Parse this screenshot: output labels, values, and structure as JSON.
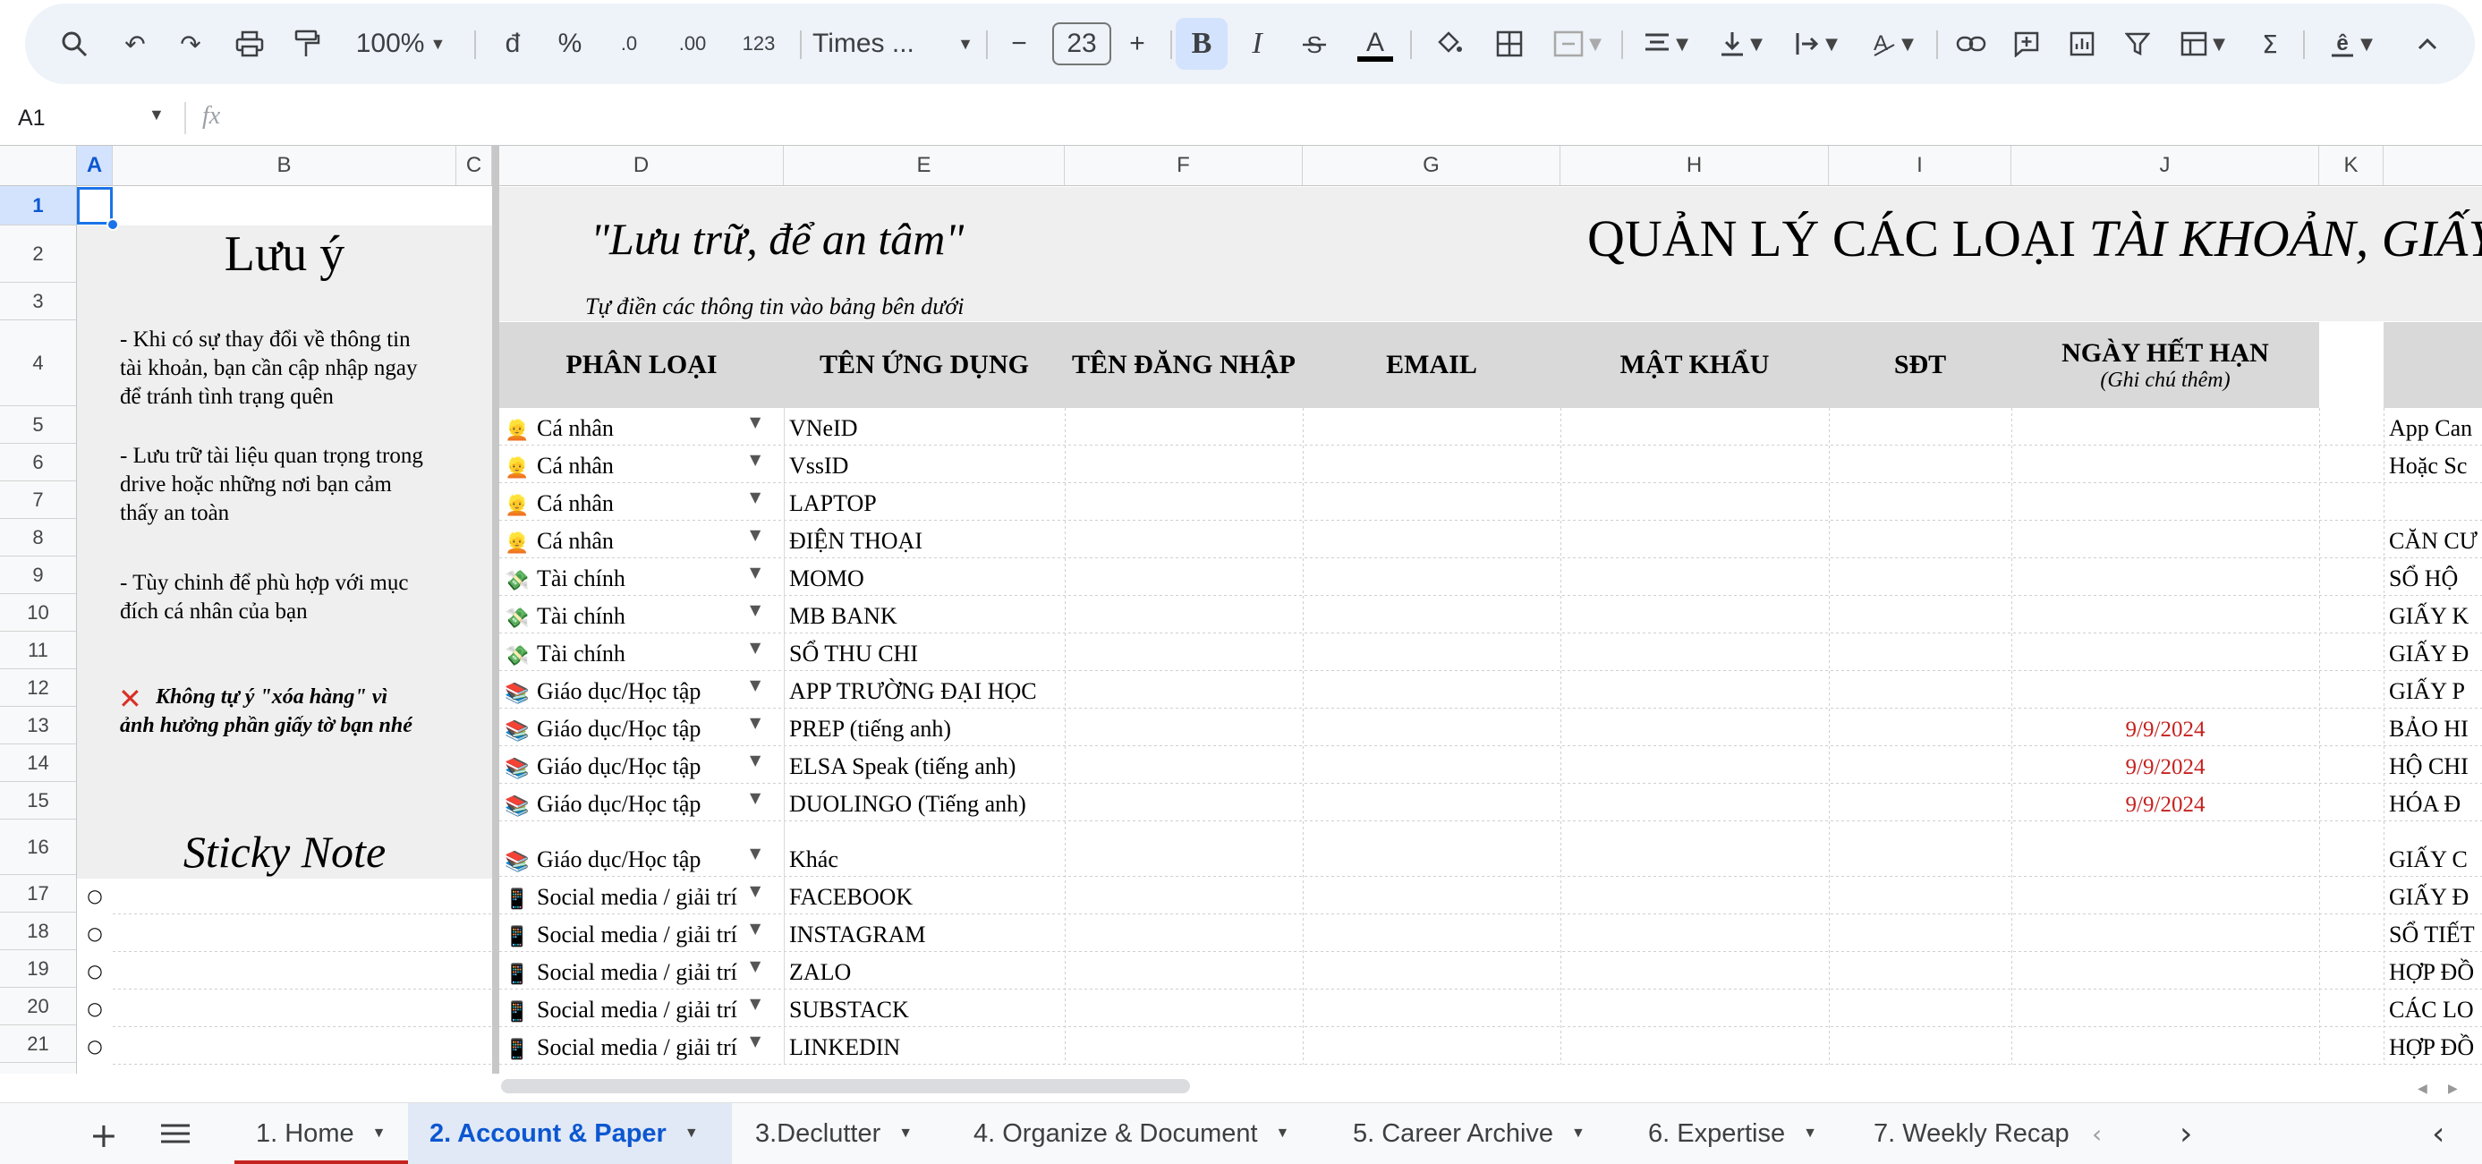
{
  "toolbar": {
    "zoom": "100%",
    "currency": "đ",
    "percent": "%",
    "dec_decrease": ".0",
    "dec_increase": ".00",
    "number_format": "123",
    "font_name": "Times ...",
    "font_size": "23",
    "bold": "B",
    "italic": "I"
  },
  "formula_bar": {
    "name_box": "A1",
    "fx": "fx"
  },
  "columns": [
    "A",
    "B",
    "C",
    "D",
    "E",
    "F",
    "G",
    "H",
    "I",
    "J",
    "K"
  ],
  "rows": [
    "1",
    "2",
    "3",
    "4",
    "5",
    "6",
    "7",
    "8",
    "9",
    "10",
    "11",
    "12",
    "13",
    "14",
    "15",
    "16",
    "17",
    "18",
    "19",
    "20",
    "21"
  ],
  "notes_panel": {
    "title": "Lưu ý",
    "note1_line1": "- Khi có sự thay đổi về thông tin",
    "note1_line2": "tài khoản, bạn cần cập nhập ngay",
    "note1_line3": "để tránh tình trạng quên",
    "note2_line1": "- Lưu trữ tài liệu quan trọng trong",
    "note2_line2": "drive hoặc những nơi bạn cảm",
    "note2_line3": "thấy an toàn",
    "note3_line1": "- Tùy chinh để phù hợp với mục",
    "note3_line2": "đích cá nhân của bạn",
    "warning_icon": "✕",
    "warning_line1": "Không tự ý \"xóa hàng\" vì",
    "warning_line2": "ảnh hưởng phần giấy tờ bạn nhé",
    "sticky_title": "Sticky Note",
    "bullet": "○"
  },
  "banner": {
    "slogan": "\"Lưu trữ, để an tâm\"",
    "title_plain": "QUẢN LÝ CÁC LOẠI ",
    "title_italic": "TÀI KHOẢN, GIẤY",
    "instruction": "Tự điền các thông tin vào bảng bên dưới"
  },
  "table_headers": {
    "category": "PHÂN LOẠI",
    "app_name": "TÊN ỨNG DỤNG",
    "username": "TÊN ĐĂNG NHẬP",
    "email": "EMAIL",
    "password": "MẬT KHẨU",
    "phone": "SĐT",
    "expiry": "NGÀY HẾT HẠN",
    "expiry_note": "(Ghi chú thêm)"
  },
  "accounts": [
    {
      "icon": "👱",
      "category": "Cá nhân",
      "app": "VNeID",
      "expiry": "",
      "right": "App Can"
    },
    {
      "icon": "👱",
      "category": "Cá nhân",
      "app": "VssID",
      "expiry": "",
      "right": "Hoặc Sc"
    },
    {
      "icon": "👱",
      "category": "Cá nhân",
      "app": "LAPTOP",
      "expiry": "",
      "right": ""
    },
    {
      "icon": "👱",
      "category": "Cá nhân",
      "app": "ĐIỆN THOẠI",
      "expiry": "",
      "right": "CĂN CƯ"
    },
    {
      "icon": "💸",
      "category": "Tài chính",
      "app": "MOMO",
      "expiry": "",
      "right": "SỔ HỘ"
    },
    {
      "icon": "💸",
      "category": "Tài chính",
      "app": "MB BANK",
      "expiry": "",
      "right": "GIẤY K"
    },
    {
      "icon": "💸",
      "category": "Tài chính",
      "app": "SỔ THU CHI",
      "expiry": "",
      "right": "GIẤY Đ"
    },
    {
      "icon": "📚",
      "category": "Giáo dục/Học tập",
      "app": "APP TRƯỜNG ĐẠI HỌC",
      "expiry": "",
      "right": "GIẤY P"
    },
    {
      "icon": "📚",
      "category": "Giáo dục/Học tập",
      "app": "PREP (tiếng anh)",
      "expiry": "9/9/2024",
      "right": "BẢO HI"
    },
    {
      "icon": "📚",
      "category": "Giáo dục/Học tập",
      "app": "ELSA Speak (tiếng anh)",
      "expiry": "9/9/2024",
      "right": "HỘ CHI"
    },
    {
      "icon": "📚",
      "category": "Giáo dục/Học tập",
      "app": "DUOLINGO (Tiếng anh)",
      "expiry": "9/9/2024",
      "right": "HÓA Đ"
    },
    {
      "icon": "📚",
      "category": "Giáo dục/Học tập",
      "app": "Khác",
      "expiry": "",
      "right": "GIẤY C"
    },
    {
      "icon": "📱",
      "category": "Social media / giải trí",
      "app": "FACEBOOK",
      "expiry": "",
      "right": "GIẤY Đ"
    },
    {
      "icon": "📱",
      "category": "Social media / giải trí",
      "app": "INSTAGRAM",
      "expiry": "",
      "right": "SỔ TIẾT"
    },
    {
      "icon": "📱",
      "category": "Social media / giải trí",
      "app": "ZALO",
      "expiry": "",
      "right": "HỢP ĐỒ"
    },
    {
      "icon": "📱",
      "category": "Social media / giải trí",
      "app": "SUBSTACK",
      "expiry": "",
      "right": "CÁC LO"
    },
    {
      "icon": "📱",
      "category": "Social media / giải trí",
      "app": "LINKEDIN",
      "expiry": "",
      "right": "HỢP ĐỒ"
    }
  ],
  "sheet_tabs": [
    "1. Home",
    "2. Account & Paper",
    "3.Declutter",
    "4. Organize & Document",
    "5. Career Archive",
    "6. Expertise",
    "7. Weekly Recap"
  ],
  "colors": {
    "accent_blue": "#0b57d0",
    "expiry_red": "#c5221f",
    "header_gray": "#d9d9d9",
    "panel_gray": "#efefef"
  }
}
